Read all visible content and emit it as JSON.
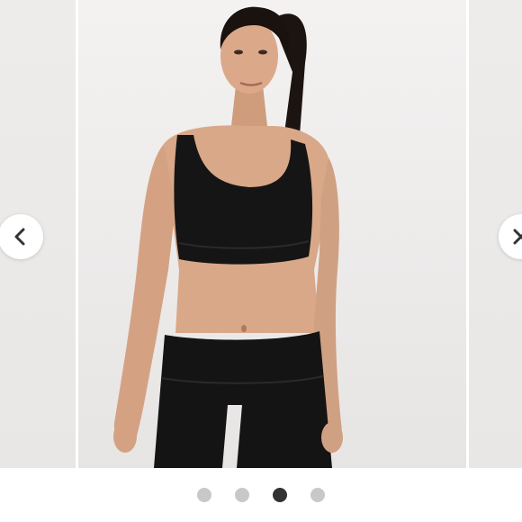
{
  "gallery": {
    "image_subject": "athlete-black-sports-bra-and-leggings",
    "colors": {
      "background": "#ebe9e8",
      "skin": "#d9a888",
      "garment": "#151515",
      "nav_button": "#ffffff",
      "dot_inactive": "#c8c8c8",
      "dot_active": "#333333"
    },
    "prev_icon": "chevron-left-icon",
    "next_icon": "close-x-icon",
    "dots": [
      {
        "active": false
      },
      {
        "active": false
      },
      {
        "active": true
      },
      {
        "active": false
      }
    ]
  }
}
